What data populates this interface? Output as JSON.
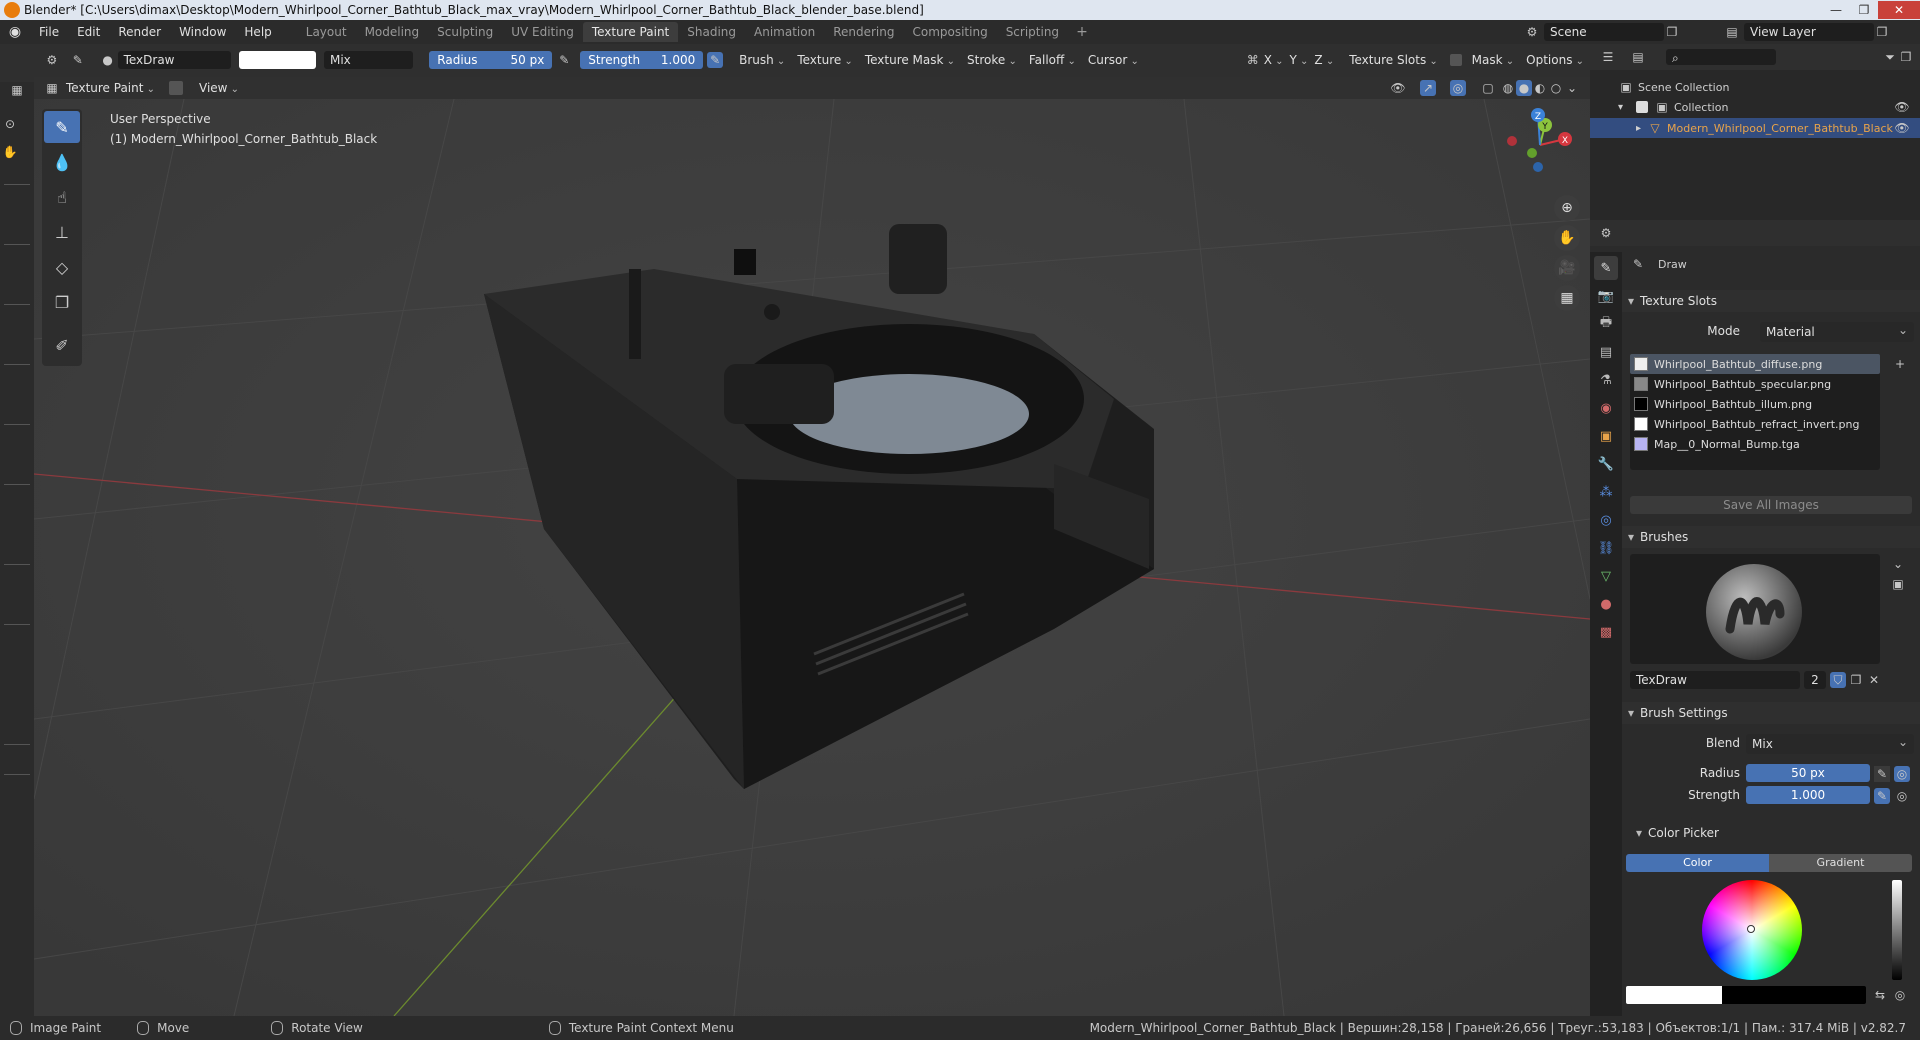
{
  "titlebar": {
    "title": "Blender* [C:\\Users\\dimax\\Desktop\\Modern_Whirlpool_Corner_Bathtub_Black_max_vray\\Modern_Whirlpool_Corner_Bathtub_Black_blender_base.blend]",
    "minimize": "—",
    "maximize": "❐",
    "close": "✕"
  },
  "menubar": {
    "menus": [
      "File",
      "Edit",
      "Render",
      "Window",
      "Help"
    ],
    "workspaces": [
      "Layout",
      "Modeling",
      "Sculpting",
      "UV Editing",
      "Texture Paint",
      "Shading",
      "Animation",
      "Rendering",
      "Compositing",
      "Scripting"
    ],
    "active_workspace": "Texture Paint",
    "add_workspace": "+",
    "scene": "Scene",
    "view_layer": "View Layer"
  },
  "toolhdr": {
    "brush_name": "TexDraw",
    "blend": "Mix",
    "radius_label": "Radius",
    "radius_value": "50 px",
    "strength_label": "Strength",
    "strength_value": "1.000",
    "dropdowns": [
      "Brush",
      "Texture",
      "Texture Mask",
      "Stroke",
      "Falloff",
      "Cursor"
    ],
    "axes": [
      "X",
      "Y",
      "Z"
    ],
    "texture_slots": "Texture Slots",
    "mask": "Mask",
    "options": "Options"
  },
  "vphdr": {
    "mode": "Texture Paint",
    "view": "View"
  },
  "viewport": {
    "perspective": "User Perspective",
    "object": "(1) Modern_Whirlpool_Corner_Bathtub_Black",
    "gizmo_labels": {
      "x": "X",
      "y": "Y",
      "z": "Z"
    }
  },
  "outliner": {
    "search_placeholder": "",
    "scene_collection": "Scene Collection",
    "collection": "Collection",
    "object": "Modern_Whirlpool_Corner_Bathtub_Black"
  },
  "props": {
    "tool_name": "Draw",
    "texture_slots": {
      "header": "Texture Slots",
      "mode_label": "Mode",
      "mode_value": "Material",
      "slots": [
        "Whirlpool_Bathtub_diffuse.png",
        "Whirlpool_Bathtub_specular.png",
        "Whirlpool_Bathtub_illum.png",
        "Whirlpool_Bathtub_refract_invert.png",
        "Map__0_Normal_Bump.tga"
      ],
      "save_all": "Save All Images"
    },
    "brushes": {
      "header": "Brushes",
      "name": "TexDraw",
      "users": "2"
    },
    "brush_settings": {
      "header": "Brush Settings",
      "blend_label": "Blend",
      "blend_value": "Mix",
      "radius_label": "Radius",
      "radius_value": "50 px",
      "strength_label": "Strength",
      "strength_value": "1.000"
    },
    "color_picker": {
      "header": "Color Picker",
      "tab_color": "Color",
      "tab_gradient": "Gradient"
    }
  },
  "statusbar": {
    "items": [
      "Image Paint",
      "Move",
      "Rotate View",
      "Texture Paint Context Menu"
    ],
    "stats": "Modern_Whirlpool_Corner_Bathtub_Black | Вершин:28,158 | Граней:26,656 | Треуг.:53,183 | Объектов:1/1 | Пам.: 317.4 MiB | v2.82.7"
  },
  "colors": {
    "accent": "#4772b3",
    "active_object": "#e8a34a",
    "axis_x": "#d5373f",
    "axis_y": "#8cc43d",
    "axis_z": "#3b82d8"
  }
}
